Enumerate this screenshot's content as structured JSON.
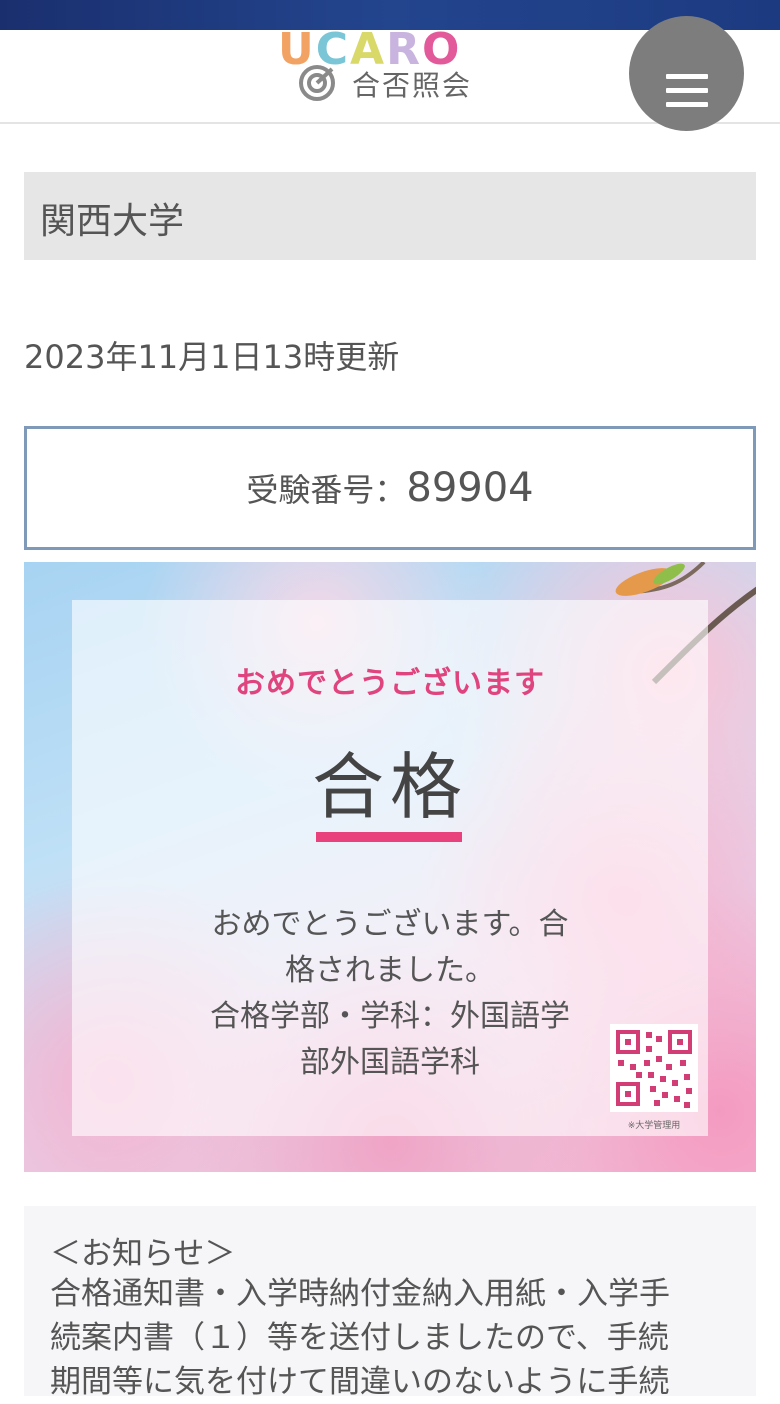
{
  "header": {
    "logo_letters": [
      {
        "char": "U",
        "color": "#f2a364"
      },
      {
        "char": "C",
        "color": "#7ac5d6"
      },
      {
        "char": "A",
        "color": "#d9d96a"
      },
      {
        "char": "R",
        "color": "#c8b4de"
      },
      {
        "char": "O",
        "color": "#e25a9a"
      }
    ],
    "logo_subtitle": "合否照会",
    "menu_icon": "hamburger-icon"
  },
  "university": {
    "name": "関西大学"
  },
  "updated": "2023年11月1日13時更新",
  "exam": {
    "label": "受験番号：",
    "number": "89904"
  },
  "result": {
    "heading": "おめでとうございます",
    "status": "合格",
    "message_lines": [
      "おめでとうございます。合",
      "格されました。",
      "合格学部・学科：外国語学",
      "部外国語学科"
    ],
    "qr_note": "※大学管理用",
    "accent_color": "#e8417c"
  },
  "notice": {
    "title": "＜お知らせ＞",
    "body_lines": [
      "合格通知書・入学時納付金納入用紙・入学手",
      "続案内書（１）等を送付しましたので、手続",
      "期間等に気を付けて間違いのないように手続"
    ]
  }
}
